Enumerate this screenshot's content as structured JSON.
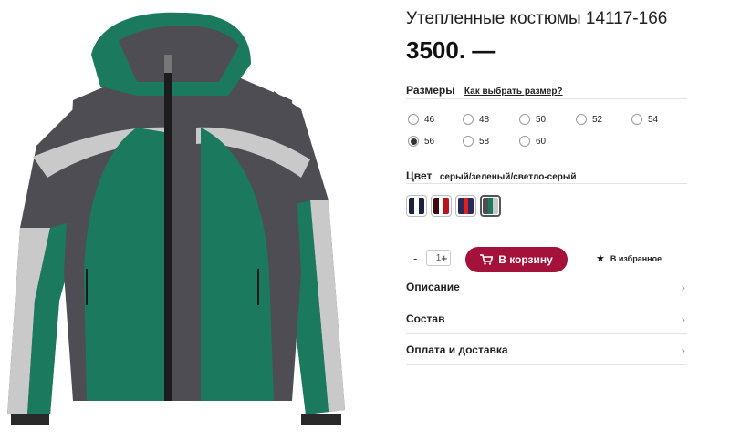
{
  "product": {
    "title": "Утепленные костюмы 14117-166",
    "price": "3500. —",
    "image_alt": "jacket-product-photo"
  },
  "sizes": {
    "label": "Размеры",
    "guide_link": "Как выбрать размер?",
    "options": [
      {
        "label": "46",
        "checked": false
      },
      {
        "label": "48",
        "checked": false
      },
      {
        "label": "50",
        "checked": false
      },
      {
        "label": "52",
        "checked": false
      },
      {
        "label": "54",
        "checked": false
      },
      {
        "label": "56",
        "checked": true
      },
      {
        "label": "58",
        "checked": false
      },
      {
        "label": "60",
        "checked": false
      }
    ]
  },
  "color": {
    "label": "Цвет",
    "value": "серый/зеленый/светло-серый",
    "swatches": [
      {
        "colors": [
          "#1d2140",
          "#ffffff",
          "#1d2140"
        ],
        "selected": false
      },
      {
        "colors": [
          "#3b0b12",
          "#ffffff",
          "#b5161f"
        ],
        "selected": false
      },
      {
        "colors": [
          "#2a2a5a",
          "#e02020",
          "#2a2a5a"
        ],
        "selected": false
      },
      {
        "colors": [
          "#4d4d53",
          "#1b7a5e",
          "#c9c9c9"
        ],
        "selected": true
      }
    ]
  },
  "cart": {
    "minus": "-",
    "quantity": "1",
    "plus": "+",
    "button_label": "В корзину",
    "favorites_label": "В избранное"
  },
  "accordion": [
    {
      "label": "Описание"
    },
    {
      "label": "Состав"
    },
    {
      "label": "Оплата и доставка"
    }
  ],
  "colors": {
    "accent": "#a4123b",
    "jacket_green": "#1b7a5e",
    "jacket_dark": "#4d4d53",
    "jacket_light": "#c9c9c9"
  }
}
